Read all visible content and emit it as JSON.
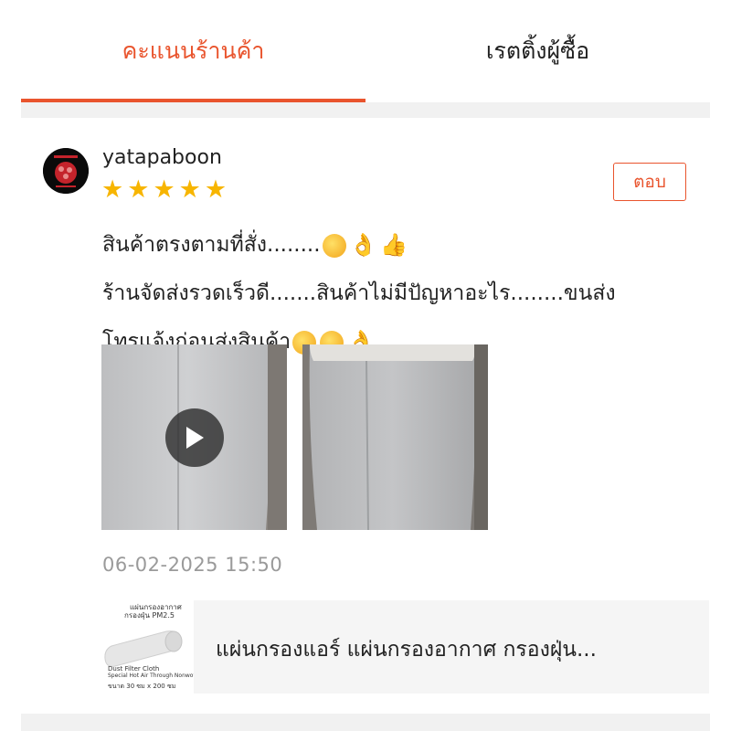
{
  "tabs": [
    {
      "label": "คะแนนร้านค้า",
      "active": true
    },
    {
      "label": "เรตติ้งผู้ซื้อ",
      "active": false
    }
  ],
  "review": {
    "username": "yatapaboon",
    "rating": 5,
    "reply_label": "ตอบ",
    "text_lines": [
      "สินค้าตรงตามที่สั่ง........",
      "ร้านจัดส่งรวดเร็วดี.......สินค้าไม่มีปัญหาอะไร........ขนส่ง",
      "โทรแจ้งก่อนส่งสินค้า"
    ],
    "timestamp": "06-02-2025 15:50",
    "media": [
      {
        "type": "video",
        "icon": "play-icon"
      },
      {
        "type": "image"
      }
    ]
  },
  "product": {
    "name": "แผ่นกรองแอร์ แผ่นกรองอากาศ กรองฝุ่น...",
    "thumb_title_1": "แผ่นกรองอากาศ",
    "thumb_title_2": "กรองฝุ่น PM2.5",
    "thumb_line_1": "Dust Filter Cloth",
    "thumb_line_2": "Special Hot Air Through Nonwovens",
    "thumb_size": "ขนาด 30 ซม x 200 ซม"
  },
  "colors": {
    "accent": "#e9542d",
    "star": "#f7b500",
    "muted": "#9a9a9a",
    "divider": "#f1f1f1"
  }
}
